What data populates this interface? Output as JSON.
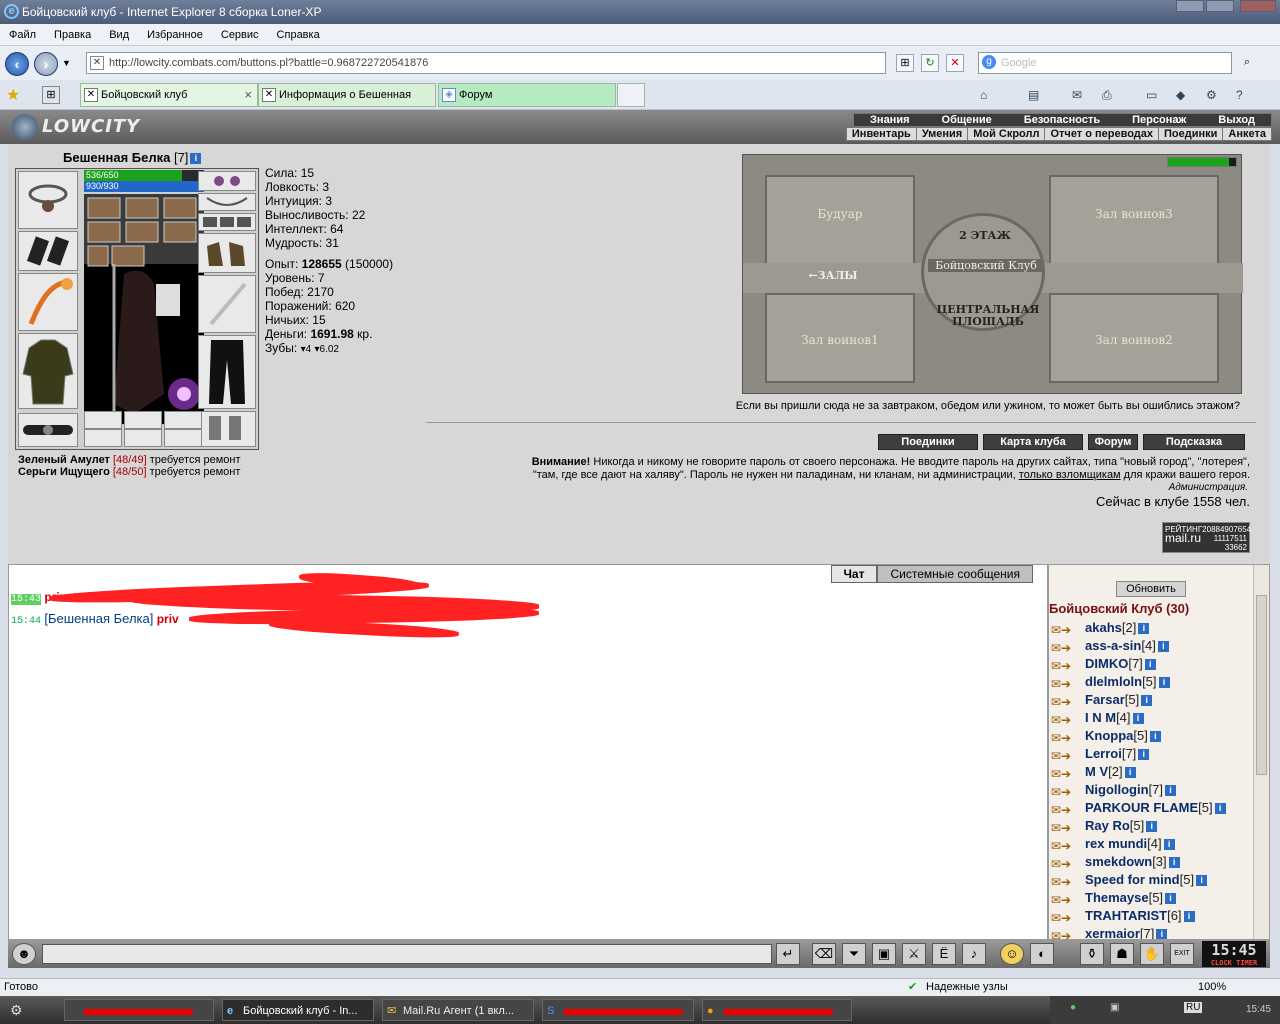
{
  "window": {
    "title": "Бойцовский клуб - Internet Explorer 8 сборка Loner-XP"
  },
  "menu": [
    "Файл",
    "Правка",
    "Вид",
    "Избранное",
    "Сервис",
    "Справка"
  ],
  "address": {
    "url": "http://lowcity.combats.com/buttons.pl?battle=0.968722720541876",
    "search_placeholder": "Google"
  },
  "tabs": [
    {
      "label": "Бойцовский клуб",
      "close": "×"
    },
    {
      "label": "Информация о Бешенная Белка"
    },
    {
      "label": "Форум"
    }
  ],
  "game": {
    "logo": "LOWCITY",
    "topmenu": [
      "Знания",
      "Общение",
      "Безопасность",
      "Персонаж",
      "Выход"
    ],
    "submenu": [
      "Инвентарь",
      "Умения",
      "Мой Скролл",
      "Отчет о переводах",
      "Поединки",
      "Анкета"
    ]
  },
  "character": {
    "name": "Бешенная Белка",
    "level": "[7]",
    "hp": "536/650",
    "hp_fraction": 0.82,
    "mp": "930/930",
    "mp_fraction": 1.0,
    "stats": [
      {
        "label": "Сила:",
        "value": "15"
      },
      {
        "label": "Ловкость:",
        "value": "3"
      },
      {
        "label": "Интуиция:",
        "value": "3"
      },
      {
        "label": "Выносливость:",
        "value": "22"
      },
      {
        "label": "Интеллект:",
        "value": "64"
      },
      {
        "label": "Мудрость:",
        "value": "31"
      }
    ],
    "exp_label": "Опыт:",
    "exp_value": "128655",
    "exp_next": "(150000)",
    "level_label": "Уровень:",
    "level_value": "7",
    "wins_label": "Побед:",
    "wins_value": "2170",
    "losses_label": "Поражений:",
    "losses_value": "620",
    "draws_label": "Ничьих:",
    "draws_value": "15",
    "money_label": "Деньги:",
    "money_value": "1691.98",
    "money_unit": "кр.",
    "teeth_label": "Зубы:",
    "teeth_a": "4",
    "teeth_b": "6.02"
  },
  "repairs": [
    {
      "item": "Зеленый Амулет",
      "dur": "[48/49]",
      "note": "требуется ремонт"
    },
    {
      "item": "Серьги Ищущего",
      "dur": "[48/50]",
      "note": "требуется ремонт"
    }
  ],
  "map": {
    "rooms": [
      "Будуар",
      "Зал воинов3",
      "Зал воинов1",
      "Зал воинов2"
    ],
    "floor": "2 ЭТАЖ",
    "club": "Бойцовский Клуб",
    "halls": "←ЗАЛЫ",
    "square_1": "ЦЕНТРАЛЬНАЯ",
    "square_2": "ПЛОЩАДЬ",
    "caption": "Если вы пришли сюда не за завтраком, обедом или ужином, то может быть вы ошиблись этажом?"
  },
  "buttons": [
    "Поединки",
    "Карта клуба",
    "Форум",
    "Подсказка"
  ],
  "warning": {
    "bold": "Внимание!",
    "text1": " Никогда и никому не говорите пароль от своего персонажа. Не вводите пароль на других сайтах, типа \"новый город\", \"лотерея\",",
    "text2": "\"там, где все дают на халяву\". Пароль не нужен ни паладинам, ни кланам, ни администрации, ",
    "link": "только взломщикам",
    "text3": " для кражи вашего героя.",
    "admin": "Администрация.",
    "online": "Сейчас в клубе 1558 чел."
  },
  "rating": {
    "l1": "РЕЙТИНГ",
    "n1": "20884907654",
    "logo": "mail.ru",
    "n2": "11117511",
    "n3": "33662"
  },
  "chat": {
    "tabs": [
      "Чат",
      "Системные сообщения"
    ],
    "lines": [
      {
        "time": "15:43",
        "nick": "",
        "text": "private"
      },
      {
        "time": "15:44",
        "nick": "[Бешенная Белка]",
        "text": "priv"
      }
    ]
  },
  "online_panel": {
    "refresh": "Обновить",
    "room": "Бойцовский Клуб (30)",
    "users": [
      {
        "name": "akahs",
        "lv": "[2]"
      },
      {
        "name": "ass-a-sin",
        "lv": "[4]"
      },
      {
        "name": "DIMKO",
        "lv": "[7]"
      },
      {
        "name": "dlelmloln",
        "lv": "[5]"
      },
      {
        "name": "Farsar",
        "lv": "[5]"
      },
      {
        "name": "I N M",
        "lv": "[4]"
      },
      {
        "name": "Knoppa",
        "lv": "[5]"
      },
      {
        "name": "Lerroi",
        "lv": "[7]"
      },
      {
        "name": "M V",
        "lv": "[2]"
      },
      {
        "name": "Nigollogin",
        "lv": "[7]"
      },
      {
        "name": "PARKOUR FLAME",
        "lv": "[5]"
      },
      {
        "name": "Ray Ro",
        "lv": "[5]"
      },
      {
        "name": "rex mundi",
        "lv": "[4]"
      },
      {
        "name": "smekdown",
        "lv": "[3]"
      },
      {
        "name": "Speed for mind",
        "lv": "[5]"
      },
      {
        "name": "Themayse",
        "lv": "[5]"
      },
      {
        "name": "TRAHTARIST",
        "lv": "[6]"
      },
      {
        "name": "xermaior",
        "lv": "[7]"
      }
    ]
  },
  "gamebar": {
    "clock": "15:45",
    "clock_label": "CLOCK TIMER",
    "exit": "EXIT"
  },
  "status": {
    "left": "Готово",
    "zone": "Надежные узлы",
    "zoom": "100%"
  },
  "taskbar": {
    "tasks": [
      "Бойцовский клуб - In...",
      "Mail.Ru Агент (1 вкл..."
    ],
    "lang": "RU",
    "time": "15:45"
  },
  "colors": {
    "accent": "#2b6cc4",
    "hp": "#1aa31a",
    "mp": "#2166c8",
    "warn": "#c00000"
  }
}
